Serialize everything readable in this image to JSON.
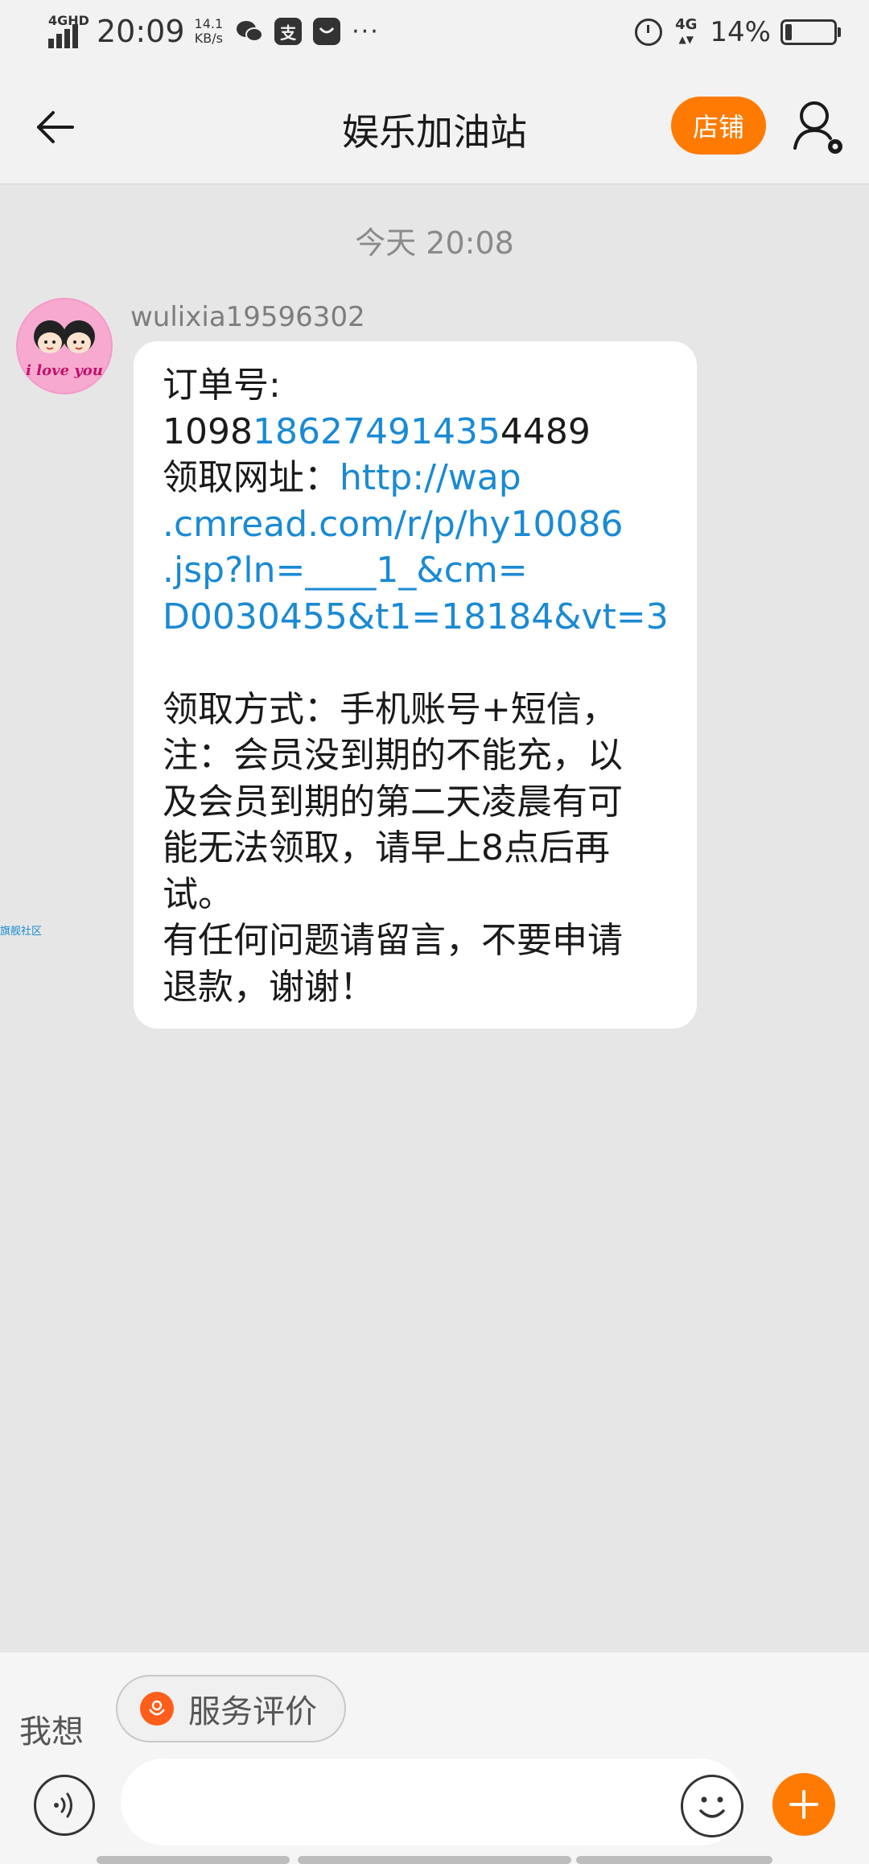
{
  "status_bar": {
    "network": "4GHD",
    "time": "20:09",
    "speed_value": "14.1",
    "speed_unit": "KB/s",
    "alipay_label": "支",
    "more": "···",
    "right_network": "4G",
    "battery_text": "14%",
    "battery_level": 0.14
  },
  "header": {
    "title": "娱乐加油站",
    "shop_label": "店铺"
  },
  "chat": {
    "timestamp": "今天  20:08",
    "side_link": "旗舰社区",
    "message": {
      "sender": "wulixia19596302",
      "avatar_text": "i love you",
      "order_label": "订单号:",
      "order_prefix": "1098",
      "order_link": "18627491435",
      "order_suffix": "4489",
      "url_label": "领取网址：",
      "url_parts": [
        "http://wap",
        ".cmread.com/r/p/hy10086",
        ".jsp?ln=____1_&cm=",
        "D0030455&t1=18184&vt=3"
      ],
      "body_lines": [
        "领取方式：手机账号+短信，",
        "注：会员没到期的不能充，以",
        "及会员到期的第二天凌晨有可",
        "能无法领取，请早上8点后再",
        "试。",
        "有任何问题请留言，不要申请",
        "退款，谢谢！"
      ]
    }
  },
  "bottom": {
    "want_label": "我想",
    "review_label": "服务评价",
    "input_placeholder": ""
  },
  "colors": {
    "accent": "#ff7a00",
    "link": "#1a8ad4",
    "chat_bg": "#e6e6e6"
  },
  "icons": {
    "back": "arrow-left-icon",
    "profile": "user-settings-icon",
    "voice": "voice-icon",
    "emoji": "smile-icon",
    "plus": "plus-icon",
    "review": "flower-icon"
  }
}
